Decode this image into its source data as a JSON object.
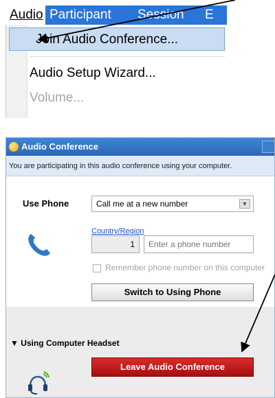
{
  "menubar": {
    "items": [
      {
        "label": "Audio",
        "underline": "A"
      },
      {
        "label": "Participant",
        "underline": "t"
      },
      {
        "label": "Session",
        "underline": "n"
      },
      {
        "label": "E"
      }
    ]
  },
  "dropdown": {
    "join": "Join Audio Conference...",
    "wizard": "Audio Setup Wizard...",
    "volume": "Volume..."
  },
  "window": {
    "title": "Audio Conference",
    "info": "You are participating in this audio conference using your computer.",
    "phone": {
      "section_label": "Use Phone",
      "select_value": "Call me at a new number",
      "country_link": "Country/Region",
      "country_code": "1",
      "phone_placeholder": "Enter a phone number",
      "remember_label": "Remember phone number on this computer",
      "switch_button": "Switch to Using Phone"
    },
    "headset": {
      "section_label": "▼ Using Computer Headset",
      "leave_button": "Leave Audio Conference"
    }
  },
  "colors": {
    "menu_highlight": "#2b74d8",
    "titlebar": "#2a67b6",
    "leave_button": "#c41a1a",
    "link": "#1f4fbf"
  },
  "icons": [
    "phone-icon",
    "headset-icon",
    "dropdown-arrow-icon",
    "title-icon",
    "window-controls-icon"
  ]
}
